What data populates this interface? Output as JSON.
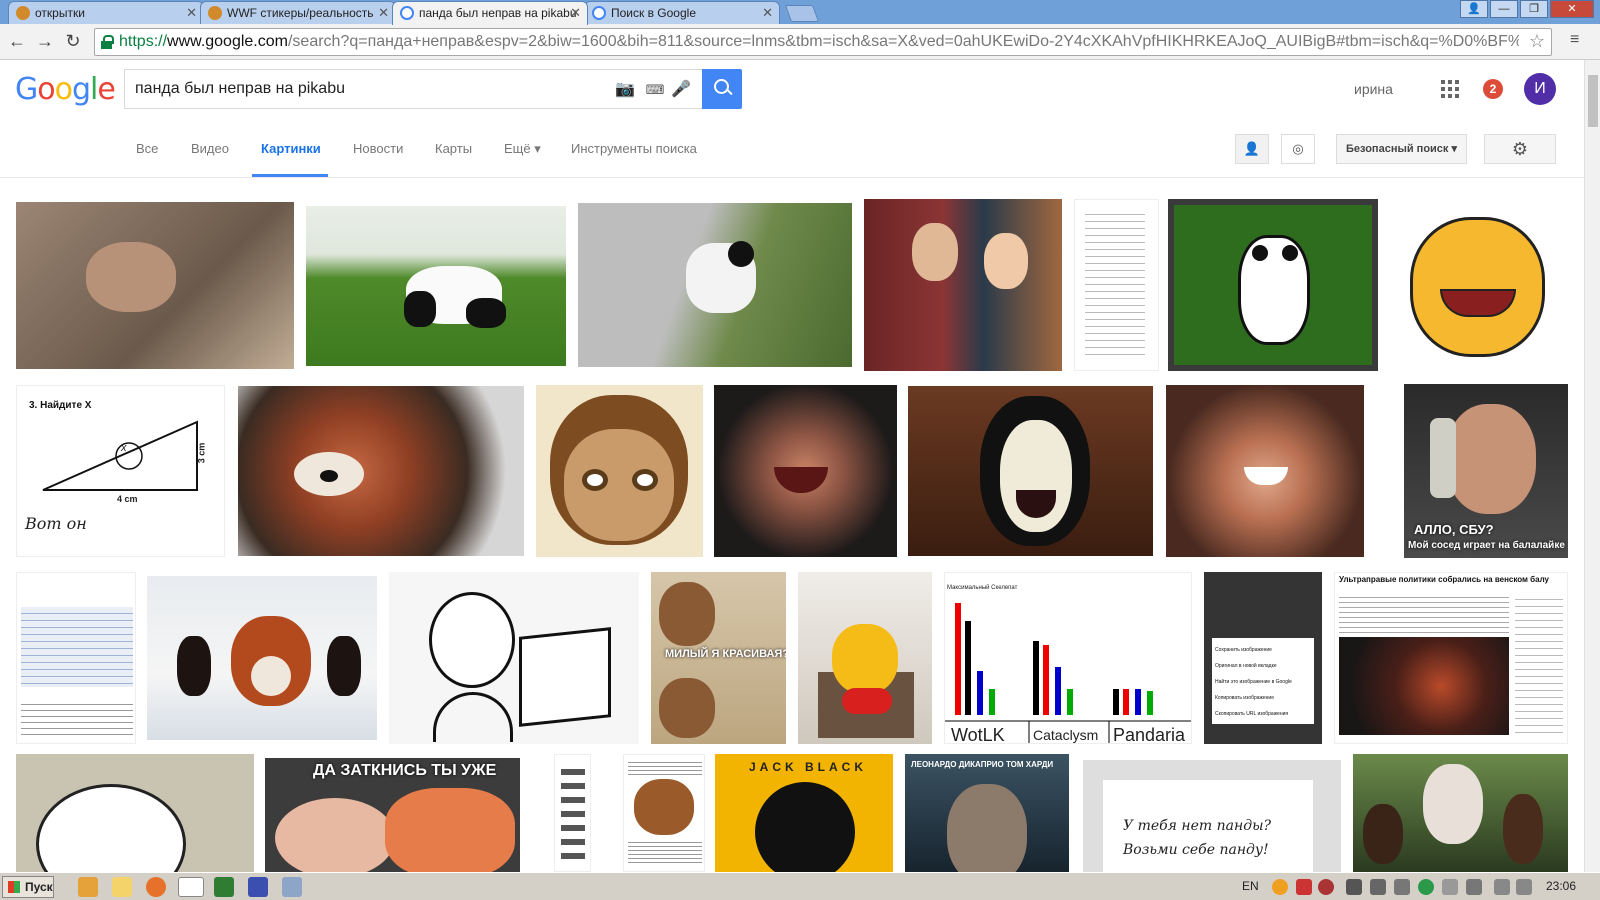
{
  "browser": {
    "tabs": [
      {
        "title": "открытки"
      },
      {
        "title": "WWF стикеры/реальность"
      },
      {
        "title": "панда был неправ на pikabu"
      },
      {
        "title": "Поиск в Google"
      }
    ],
    "url_scheme": "https://",
    "url_host": "www.google.com",
    "url_rest": "/search?q=панда+неправ&espv=2&biw=1600&bih=811&source=lnms&tbm=isch&sa=X&ved=0ahUKEwiDo-2Y4cXKAhVpfHIKHRKEAJoQ_AUIBigB#tbm=isch&q=%D0%BF%D0"
  },
  "google": {
    "logo": "Google",
    "query": "панда был неправ на pikabu",
    "user_name": "ирина",
    "notifications": "2",
    "avatar_letter": "И"
  },
  "nav": {
    "tabs": [
      "Все",
      "Видео",
      "Картинки",
      "Новости",
      "Карты",
      "Ещё ▾",
      "Инструменты поиска"
    ],
    "active": "Картинки",
    "safe_search": "Безопасный поиск ▾"
  },
  "captions": {
    "math_title": "3. Найдите Х",
    "math_3cm": "3 cm",
    "math_4cm": "4 cm",
    "math_x": "x",
    "math_here": "Вот он",
    "phone": "АЛЛО, СБУ?",
    "phone2": "Мой сосед играет на балалайке",
    "dog": "МИЛЫЙ Я КРАСИВАЯ?",
    "wow_top": "Максимальный Скелепат",
    "wotlk": "WotLK",
    "cataclysm": "Cataclysm",
    "pandaria": "Pandaria",
    "news_title": "Ультраправые политики собрались на венском балу",
    "shutup": "ДА ЗАТКНИСЬ ТЫ УЖЕ",
    "jackblack": "JACK BLACK",
    "leo": "ЛЕОНАРДО ДИКАПРИО  ТОМ ХАРДИ",
    "note1": "У тебя нет панды?",
    "note2": "Возьми себе панду!",
    "ctx_items": [
      "Сохранить изображение",
      "Оригинал в новой вкладке",
      "Найти это изображение в Google",
      "Копировать изображение",
      "Скопировать URL изображения"
    ]
  },
  "taskbar": {
    "start": "Пуск",
    "lang": "EN",
    "time": "23:06"
  }
}
